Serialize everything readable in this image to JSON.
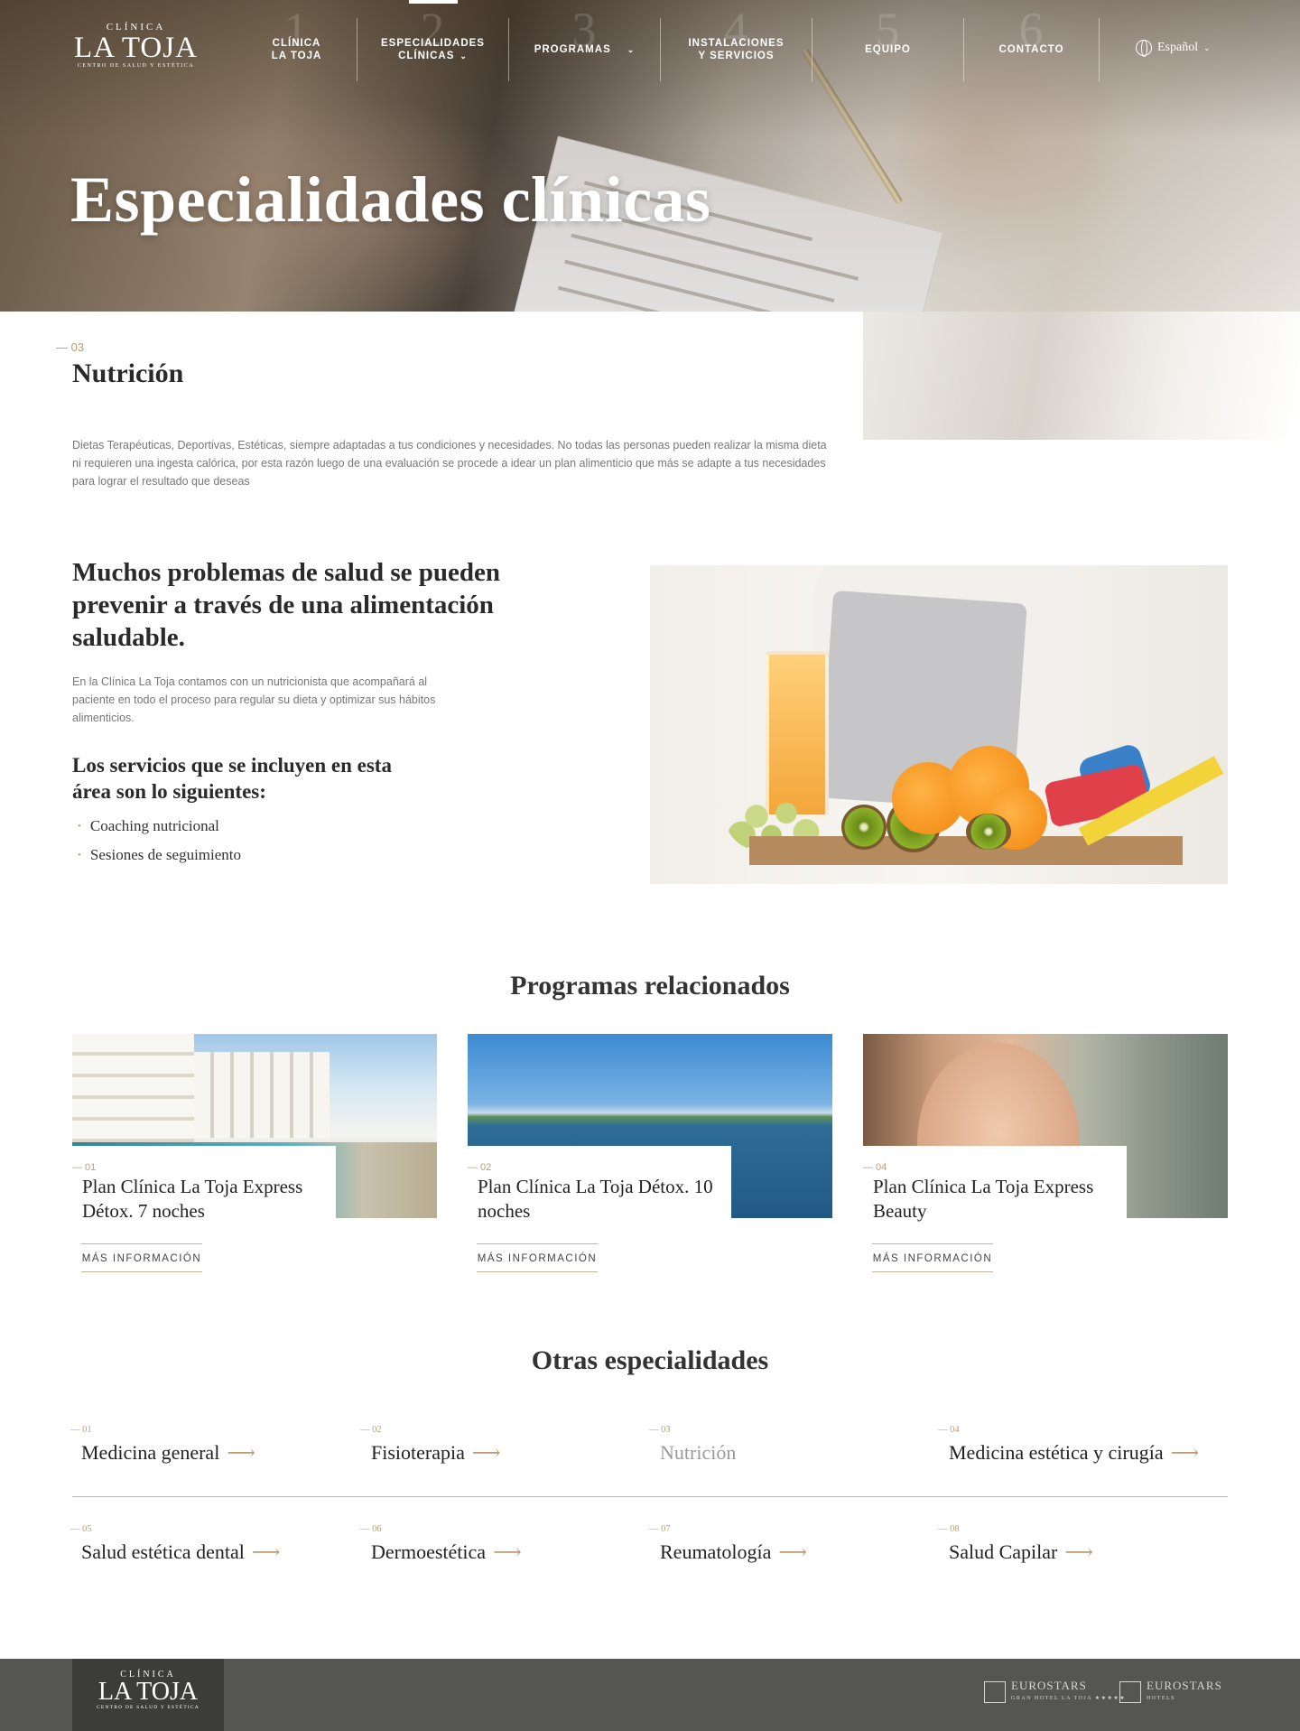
{
  "brand": {
    "top": "CLÍNICA",
    "name": "LA TOJA",
    "tagline": "CENTRO DE SALUD Y ESTÉTICA"
  },
  "nav": {
    "items": [
      {
        "num": "1",
        "label_1": "CLÍNICA",
        "label_2": "LA TOJA"
      },
      {
        "num": "2",
        "label_1": "ESPECIALIDADES",
        "label_2": "CLÍNICAS"
      },
      {
        "num": "3",
        "label_1": "PROGRAMAS",
        "label_2": ""
      },
      {
        "num": "4",
        "label_1": "INSTALACIONES",
        "label_2": "Y SERVICIOS"
      },
      {
        "num": "5",
        "label_1": "EQUIPO",
        "label_2": ""
      },
      {
        "num": "6",
        "label_1": "CONTACTO",
        "label_2": ""
      }
    ],
    "language": "Español"
  },
  "hero": {
    "title": "Especialidades clínicas"
  },
  "intro": {
    "num": "— 03",
    "title": "Nutrición",
    "text": "Dietas Terapéuticas, Deportivas, Estéticas, siempre adaptadas a tus condiciones  y necesidades.  No todas las personas pueden realizar la misma dieta ni requieren una ingesta calórica, por esta razón luego de una evaluación se procede a idear un plan alimenticio que más se adapte a tus necesidades para lograr el resultado que deseas"
  },
  "section2": {
    "heading": "Muchos problemas de salud se pueden prevenir a través de una alimentación saludable.",
    "text": "En la Clínica La Toja contamos con un nutricionista que acompañará al paciente en todo el proceso para regular su dieta y optimizar sus hábitos alimenticios.",
    "subheading": "Los servicios que se incluyen en esta área son lo siguientes:",
    "services": [
      "Coaching nutricional",
      "Sesiones de seguimiento"
    ]
  },
  "programs": {
    "title": "Programas relacionados",
    "link_label": "MÁS INFORMACIÓN",
    "items": [
      {
        "num": "— 01",
        "title": "Plan Clínica La Toja Express Détox. 7 noches"
      },
      {
        "num": "— 02",
        "title": "Plan Clínica La Toja Détox. 10 noches"
      },
      {
        "num": "— 04",
        "title": "Plan Clínica La Toja Express Beauty"
      }
    ]
  },
  "specialties": {
    "title": "Otras especialidades",
    "items": [
      {
        "num": "— 01",
        "label": "Medicina general"
      },
      {
        "num": "— 02",
        "label": "Fisioterapia"
      },
      {
        "num": "— 03",
        "label": "Nutrición"
      },
      {
        "num": "— 04",
        "label": "Medicina estética y cirugía"
      },
      {
        "num": "— 05",
        "label": "Salud estética dental"
      },
      {
        "num": "— 06",
        "label": "Dermoestética"
      },
      {
        "num": "— 07",
        "label": "Reumatología"
      },
      {
        "num": "— 08",
        "label": "Salud Capilar"
      }
    ]
  },
  "footer": {
    "partners": [
      {
        "name": "EUROSTARS",
        "sub": "GRAN HOTEL LA TOJA ★★★★★"
      },
      {
        "name": "EUROSTARS",
        "sub": "HOTELS"
      }
    ]
  },
  "colors": {
    "accent": "#b89d77",
    "footer_bg": "#555554",
    "footer_logo_bg": "#3c3c3b"
  }
}
